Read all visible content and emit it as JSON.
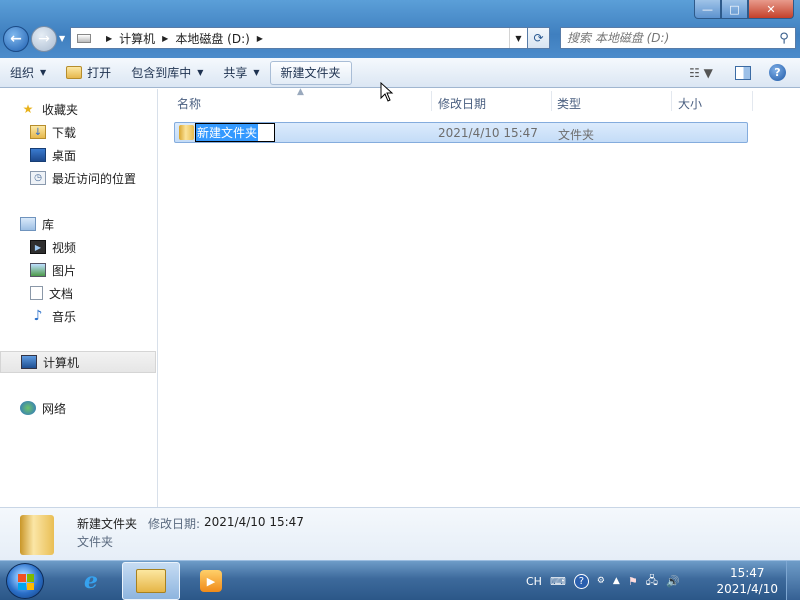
{
  "window": {
    "minimize_glyph": "—",
    "maximize_glyph": "□",
    "close_glyph": "✕"
  },
  "nav": {
    "back_glyph": "←",
    "forward_glyph": "→",
    "dropdown_glyph": "▼"
  },
  "address": {
    "crumbs": [
      "计算机",
      "本地磁盘 (D:)"
    ],
    "separator": "▶",
    "dropdown_glyph": "▼",
    "refresh_glyph": "⟳"
  },
  "search": {
    "placeholder": "搜索 本地磁盘 (D:)",
    "icon": "search-icon"
  },
  "toolbar": {
    "organize": "组织",
    "open": "打开",
    "include_library": "包含到库中",
    "share": "共享",
    "new_folder": "新建文件夹",
    "dropdown_glyph": "▼",
    "view_glyph": "☷ ▼",
    "help_glyph": "?"
  },
  "navpane": {
    "favorites": "收藏夹",
    "downloads": "下载",
    "desktop": "桌面",
    "recent": "最近访问的位置",
    "libraries": "库",
    "videos": "视频",
    "pictures": "图片",
    "documents": "文档",
    "music": "音乐",
    "computer": "计算机",
    "network": "网络"
  },
  "columns": {
    "name": "名称",
    "modified": "修改日期",
    "type": "类型",
    "size": "大小",
    "sort_glyph": "▲"
  },
  "files": [
    {
      "name": "新建文件夹",
      "modified": "2021/4/10 15:47",
      "type": "文件夹",
      "size": ""
    }
  ],
  "details": {
    "name": "新建文件夹",
    "modified_label": "修改日期:",
    "modified": "2021/4/10 15:47",
    "type": "文件夹"
  },
  "taskbar": {
    "lang": "CH",
    "time": "15:47",
    "date": "2021/4/10",
    "ie_glyph": "e",
    "help_glyph": "?",
    "flag_colors": [
      "#f25022",
      "#7fba00",
      "#00a4ef",
      "#ffb900"
    ]
  }
}
